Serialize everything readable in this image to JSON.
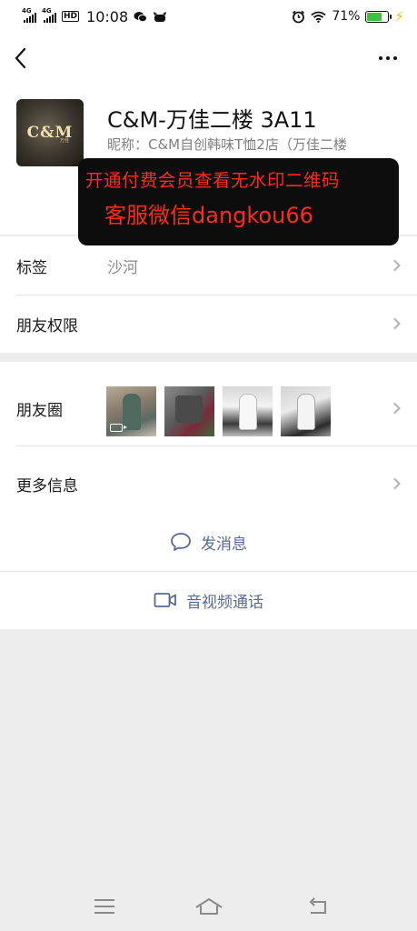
{
  "status_bar": {
    "network1": "4G",
    "network2": "4G",
    "hd_label": "HD",
    "time": "10:08",
    "battery_percent": "71%",
    "battery_level": 0.71
  },
  "profile": {
    "name": "C&M-万佳二楼 3A11",
    "nickname": "昵称：C&M自创韩味T恤2店（万佳二楼",
    "avatar_logo": "C&M",
    "avatar_sub": "万佳"
  },
  "watermark": {
    "line1": "开通付费会员查看无水印二维码",
    "line2": "客服微信dangkou66"
  },
  "rows": {
    "tags_label": "标签",
    "tags_value": "沙河",
    "permissions_label": "朋友权限",
    "moments_label": "朋友圈",
    "more_info_label": "更多信息"
  },
  "actions": {
    "message": "发消息",
    "call": "音视频通话"
  },
  "colors": {
    "link": "#576b95",
    "watermark_text": "#ff2a1a",
    "background": "#ededed"
  },
  "icons": [
    "back-arrow-icon",
    "more-dots-icon",
    "chevron-right-icon",
    "chat-bubble-icon",
    "video-camera-icon",
    "menu-icon",
    "home-icon",
    "back-nav-icon"
  ]
}
